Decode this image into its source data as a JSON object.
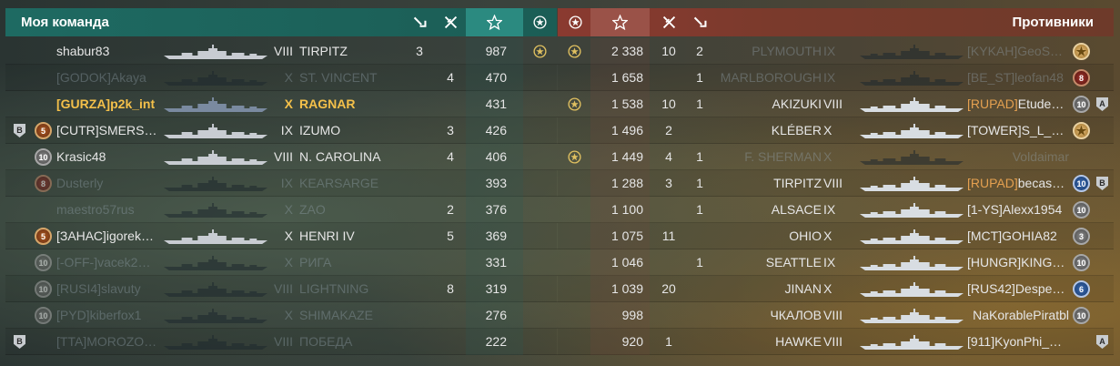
{
  "header": {
    "team_title": "Моя команда",
    "enemy_title": "Противники"
  },
  "colors": {
    "team_header": "#1e6a62",
    "enemy_header": "#8a3a30",
    "player_highlight": "#f4c04a",
    "dead_text": "#96a5af"
  },
  "icons": {
    "ships_sunk": "anchor-down-icon",
    "planes_destroyed": "plane-cross-icon",
    "base_xp": "star-icon",
    "achievement": "laurel-icon"
  },
  "my_team": [
    {
      "service": "",
      "rank": "",
      "clan": "",
      "name": "shabur83",
      "tier": "VIII",
      "ship": "TIRPITZ",
      "kills": "3",
      "planes": "",
      "xp": "987",
      "achievement": true,
      "alive": true,
      "highlight": false
    },
    {
      "service": "",
      "rank": "",
      "clan": "[GODOK]",
      "name": "Akaya",
      "tier": "X",
      "ship": "ST. VINCENT",
      "kills": "",
      "planes": "4",
      "xp": "470",
      "achievement": false,
      "alive": false,
      "highlight": false
    },
    {
      "service": "",
      "rank": "",
      "clan": "[GURZA]",
      "name": "p2k_int",
      "tier": "X",
      "ship": "RAGNAR",
      "kills": "",
      "planes": "",
      "xp": "431",
      "achievement": false,
      "alive": true,
      "highlight": true
    },
    {
      "service": "B",
      "rank": "5",
      "clan": "[CUTR]",
      "name": "SMERS…",
      "tier": "IX",
      "ship": "IZUMO",
      "kills": "",
      "planes": "3",
      "xp": "426",
      "achievement": false,
      "alive": true,
      "highlight": false
    },
    {
      "service": "",
      "rank": "10",
      "clan": "",
      "name": "Krasic48",
      "tier": "VIII",
      "ship": "N. CAROLINA",
      "kills": "",
      "planes": "4",
      "xp": "406",
      "achievement": false,
      "alive": true,
      "highlight": false
    },
    {
      "service": "",
      "rank": "8",
      "clan": "",
      "name": "Dusterly",
      "tier": "IX",
      "ship": "KEARSARGE",
      "kills": "",
      "planes": "",
      "xp": "393",
      "achievement": false,
      "alive": false,
      "highlight": false
    },
    {
      "service": "",
      "rank": "",
      "clan": "",
      "name": "maestro57rus",
      "tier": "X",
      "ship": "ZAO",
      "kills": "",
      "planes": "2",
      "xp": "376",
      "achievement": false,
      "alive": false,
      "highlight": false
    },
    {
      "service": "",
      "rank": "5",
      "clan": "[ЗАНАС]",
      "name": "igorek…",
      "tier": "X",
      "ship": "HENRI IV",
      "kills": "",
      "planes": "5",
      "xp": "369",
      "achievement": false,
      "alive": true,
      "highlight": false
    },
    {
      "service": "",
      "rank": "10",
      "clan": "[-OFF-]",
      "name": "vacek2…",
      "tier": "X",
      "ship": "РИГА",
      "kills": "",
      "planes": "",
      "xp": "331",
      "achievement": false,
      "alive": false,
      "highlight": false
    },
    {
      "service": "",
      "rank": "10",
      "clan": "[RUSI4]",
      "name": "slavuty",
      "tier": "VIII",
      "ship": "LIGHTNING",
      "kills": "",
      "planes": "8",
      "xp": "319",
      "achievement": false,
      "alive": false,
      "highlight": false
    },
    {
      "service": "",
      "rank": "10",
      "clan": "[PYD]",
      "name": "kiberfox1",
      "tier": "X",
      "ship": "SHIMAKAZE",
      "kills": "",
      "planes": "",
      "xp": "276",
      "achievement": false,
      "alive": false,
      "highlight": false
    },
    {
      "service": "B",
      "rank": "",
      "clan": "[TTA]",
      "name": "MOROZO…",
      "tier": "VIII",
      "ship": "ПОБЕДА",
      "kills": "",
      "planes": "",
      "xp": "222",
      "achievement": false,
      "alive": false,
      "highlight": false
    }
  ],
  "enemy_team": [
    {
      "achievement": true,
      "xp": "2 338",
      "planes": "10",
      "kills": "2",
      "ship": "PLYMOUTH",
      "tier": "IX",
      "clan": "[KYKAH]",
      "name": "GeoS…",
      "rank": "star",
      "service": "",
      "alive": false
    },
    {
      "achievement": false,
      "xp": "1 658",
      "planes": "",
      "kills": "1",
      "ship": "MARLBOROUGH",
      "tier": "IX",
      "clan": "[BE_ST]",
      "name": "leofan48",
      "rank": "8",
      "service": "",
      "alive": false
    },
    {
      "achievement": true,
      "xp": "1 538",
      "planes": "10",
      "kills": "1",
      "ship": "AKIZUKI",
      "tier": "VIII",
      "clan": "[RUPAD]",
      "name": "Etude…",
      "rank": "10",
      "service": "A",
      "alive": true
    },
    {
      "achievement": false,
      "xp": "1 496",
      "planes": "2",
      "kills": "",
      "ship": "KLÉBER",
      "tier": "X",
      "clan": "[TOWER]",
      "name": "S_L_…",
      "rank": "star",
      "service": "",
      "alive": true
    },
    {
      "achievement": true,
      "xp": "1 449",
      "planes": "4",
      "kills": "1",
      "ship": "F. SHERMAN",
      "tier": "X",
      "clan": "",
      "name": "Voldaimar",
      "rank": "",
      "service": "",
      "alive": false
    },
    {
      "achievement": false,
      "xp": "1 288",
      "planes": "3",
      "kills": "1",
      "ship": "TIRPITZ",
      "tier": "VIII",
      "clan": "[RUPAD]",
      "name": "becas…",
      "rank": "10",
      "service": "B",
      "alive": true
    },
    {
      "achievement": false,
      "xp": "1 100",
      "planes": "",
      "kills": "1",
      "ship": "ALSACE",
      "tier": "IX",
      "clan": "[1-YS]",
      "name": "Alexx1954",
      "rank": "10",
      "service": "",
      "alive": true
    },
    {
      "achievement": false,
      "xp": "1 075",
      "planes": "11",
      "kills": "",
      "ship": "OHIO",
      "tier": "X",
      "clan": "[MCT]",
      "name": "GOHIA82",
      "rank": "3",
      "service": "",
      "alive": true
    },
    {
      "achievement": false,
      "xp": "1 046",
      "planes": "",
      "kills": "1",
      "ship": "SEATTLE",
      "tier": "IX",
      "clan": "[HUNGR]",
      "name": "KING…",
      "rank": "10",
      "service": "",
      "alive": true
    },
    {
      "achievement": false,
      "xp": "1 039",
      "planes": "20",
      "kills": "",
      "ship": "JINAN",
      "tier": "X",
      "clan": "[RUS42]",
      "name": "Despe…",
      "rank": "6",
      "service": "",
      "alive": true
    },
    {
      "achievement": false,
      "xp": "998",
      "planes": "",
      "kills": "",
      "ship": "ЧКАЛОВ",
      "tier": "VIII",
      "clan": "",
      "name": "NaKorablePiratbl",
      "rank": "10",
      "service": "",
      "alive": true
    },
    {
      "achievement": false,
      "xp": "920",
      "planes": "1",
      "kills": "",
      "ship": "HAWKE",
      "tier": "VIII",
      "clan": "[911]",
      "name": "KyonPhi_…",
      "rank": "",
      "service": "A",
      "alive": true
    }
  ]
}
